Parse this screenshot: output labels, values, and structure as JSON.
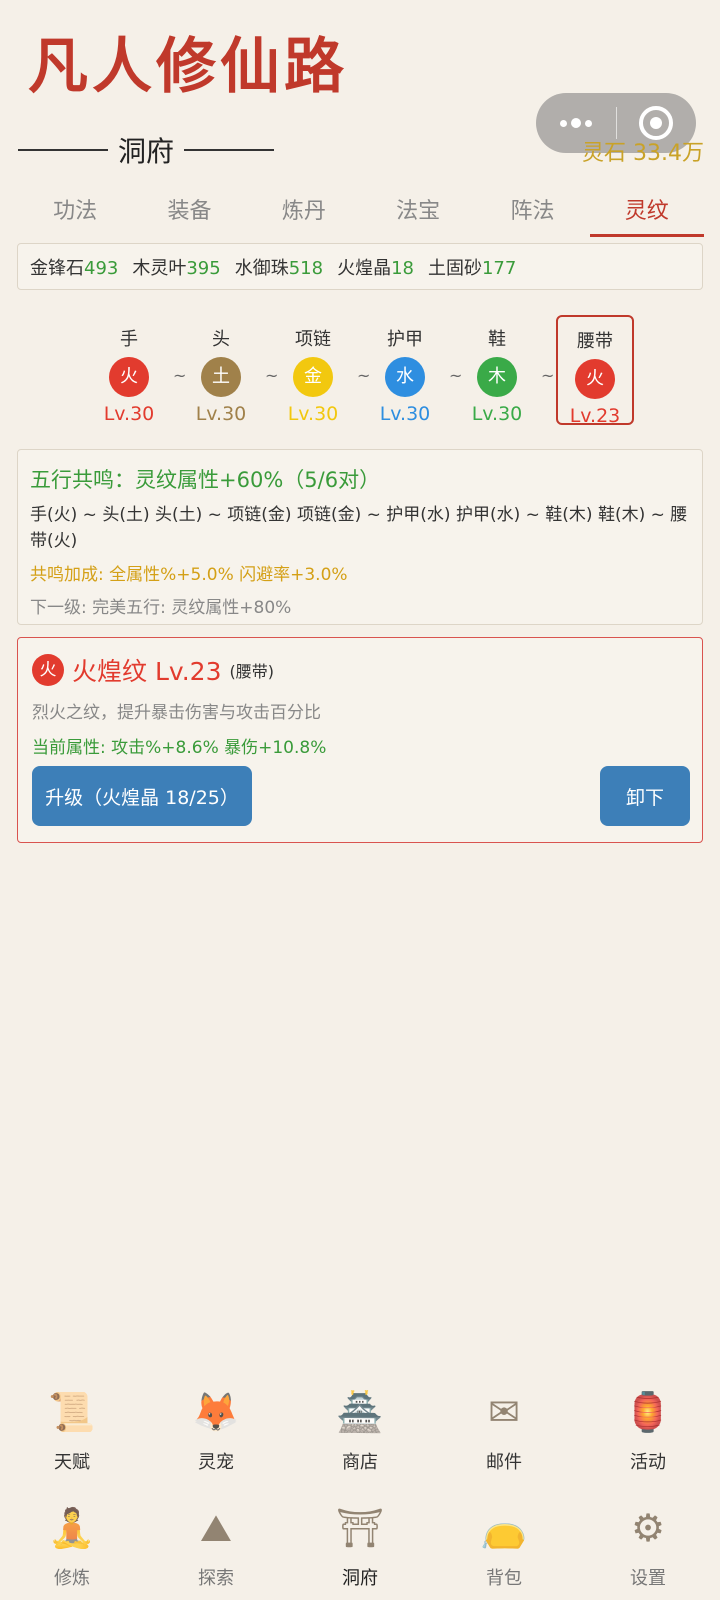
{
  "app": {
    "title": "凡人修仙路"
  },
  "header": {
    "section_title": "洞府",
    "currency": "灵石 33.4万"
  },
  "tabs": [
    {
      "label": "功法"
    },
    {
      "label": "装备"
    },
    {
      "label": "炼丹"
    },
    {
      "label": "法宝"
    },
    {
      "label": "阵法"
    },
    {
      "label": "灵纹"
    }
  ],
  "active_tab": "灵纹",
  "materials": [
    {
      "name": "金锋石",
      "count": "493"
    },
    {
      "name": "木灵叶",
      "count": "395"
    },
    {
      "name": "水御珠",
      "count": "518"
    },
    {
      "name": "火煌晶",
      "count": "18"
    },
    {
      "name": "土固砂",
      "count": "177"
    }
  ],
  "slots": [
    {
      "label": "手",
      "element": "火",
      "level": "Lv.30",
      "color": "#e23b2e"
    },
    {
      "label": "头",
      "element": "土",
      "level": "Lv.30",
      "color": "#a0814a"
    },
    {
      "label": "项链",
      "element": "金",
      "level": "Lv.30",
      "color": "#f2c80f"
    },
    {
      "label": "护甲",
      "element": "水",
      "level": "Lv.30",
      "color": "#2e8ee0"
    },
    {
      "label": "鞋",
      "element": "木",
      "level": "Lv.30",
      "color": "#3aaa48"
    },
    {
      "label": "腰带",
      "element": "火",
      "level": "Lv.23",
      "color": "#e23b2e"
    }
  ],
  "tilde": "~",
  "resonance": {
    "title": "五行共鸣：灵纹属性+60%（5/6对）",
    "pairs": "手(火) ~ 头(土)  头(土) ~ 项链(金)  项链(金) ~ 护甲(水)  护甲(水) ~ 鞋(木)  鞋(木) ~ 腰带(火)",
    "bonus": "共鸣加成: 全属性%+5.0%  闪避率+3.0%",
    "next": "下一级: 完美五行: 灵纹属性+80%"
  },
  "detail": {
    "icon_text": "火",
    "name": "火煌纹 Lv.23",
    "slot": "(腰带)",
    "description": "烈火之纹，提升暴击伤害与攻击百分比",
    "stats": "当前属性: 攻击%+8.6%  暴伤+10.8%",
    "upgrade_label": "升级（火煌晶 18/25）",
    "unequip_label": "卸下"
  },
  "nav_top": [
    {
      "label": "天赋",
      "icon": "scroll-icon",
      "glyph": "📜"
    },
    {
      "label": "灵宠",
      "icon": "fox-icon",
      "glyph": "🦊"
    },
    {
      "label": "商店",
      "icon": "pavilion-icon",
      "glyph": "🏯"
    },
    {
      "label": "邮件",
      "icon": "envelope-icon",
      "glyph": "✉"
    },
    {
      "label": "活动",
      "icon": "lantern-icon",
      "glyph": "🏮"
    }
  ],
  "nav_bottom": [
    {
      "label": "修炼",
      "icon": "meditate-icon",
      "glyph": "🧘"
    },
    {
      "label": "探索",
      "icon": "mountain-icon",
      "glyph": "⛰"
    },
    {
      "label": "洞府",
      "icon": "cave-icon",
      "glyph": "⛩"
    },
    {
      "label": "背包",
      "icon": "bag-icon",
      "glyph": "👝"
    },
    {
      "label": "设置",
      "icon": "gear-icon",
      "glyph": "⚙"
    }
  ],
  "active_nav": "洞府"
}
